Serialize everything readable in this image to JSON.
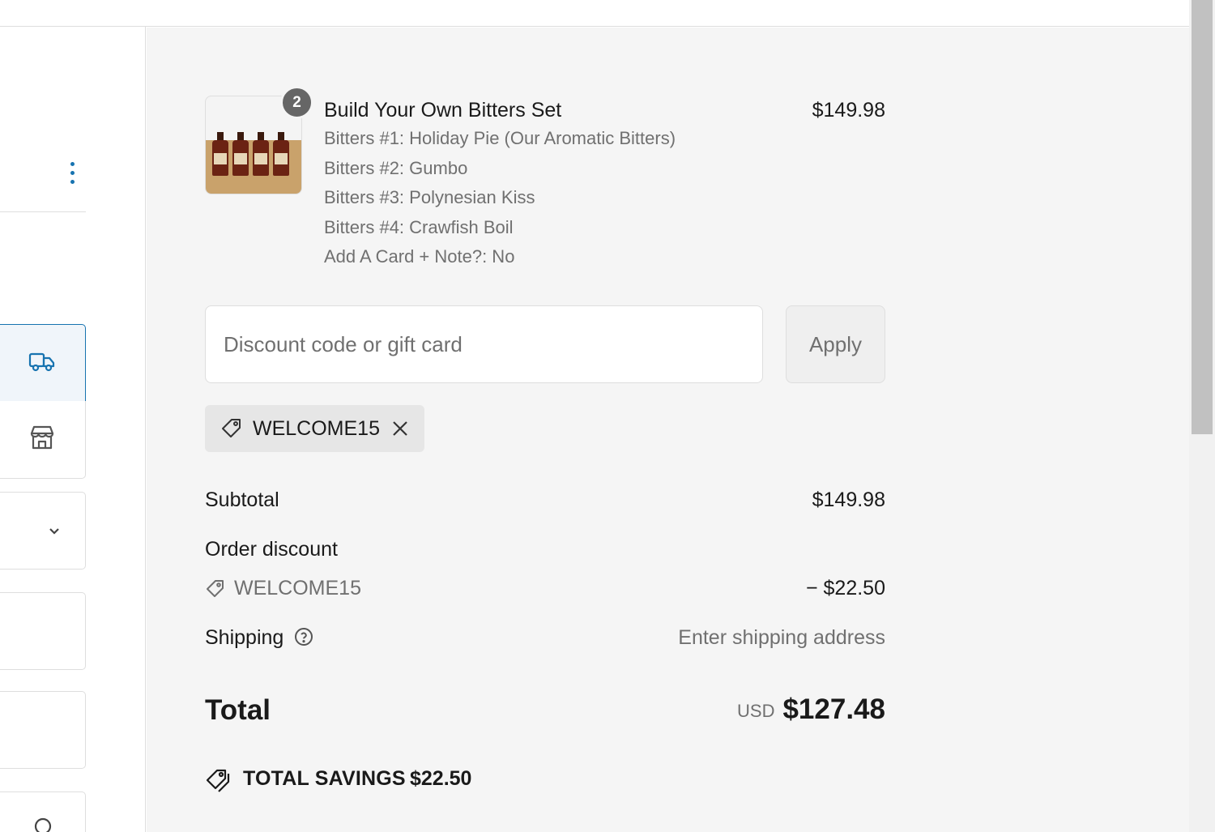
{
  "left_panel": {
    "menu_icon": "more-vertical-icon",
    "delivery_options": [
      {
        "id": "ship",
        "icon": "truck-icon",
        "selected": true
      },
      {
        "id": "pickup",
        "icon": "store-icon",
        "selected": false
      }
    ],
    "region_select_icon": "chevron-down-icon"
  },
  "product": {
    "title": "Build Your Own Bitters Set",
    "price": "$149.98",
    "quantity": "2",
    "options": [
      "Bitters #1: Holiday Pie (Our Aromatic Bitters)",
      "Bitters #2: Gumbo",
      "Bitters #3: Polynesian Kiss",
      "Bitters #4: Crawfish Boil",
      "Add A Card + Note?: No"
    ]
  },
  "discount": {
    "placeholder": "Discount code or gift card",
    "apply_label": "Apply",
    "applied_code": "WELCOME15"
  },
  "summary": {
    "subtotal_label": "Subtotal",
    "subtotal_value": "$149.98",
    "order_discount_label": "Order discount",
    "order_discount_code": "WELCOME15",
    "order_discount_value": "− $22.50",
    "shipping_label": "Shipping",
    "shipping_value": "Enter shipping address",
    "total_label": "Total",
    "total_currency": "USD",
    "total_value": "$127.48",
    "savings_label": "TOTAL SAVINGS",
    "savings_value": "$22.50"
  },
  "colors": {
    "accent": "#1773b0",
    "panel_bg": "#f5f5f5",
    "muted_text": "#707070"
  }
}
